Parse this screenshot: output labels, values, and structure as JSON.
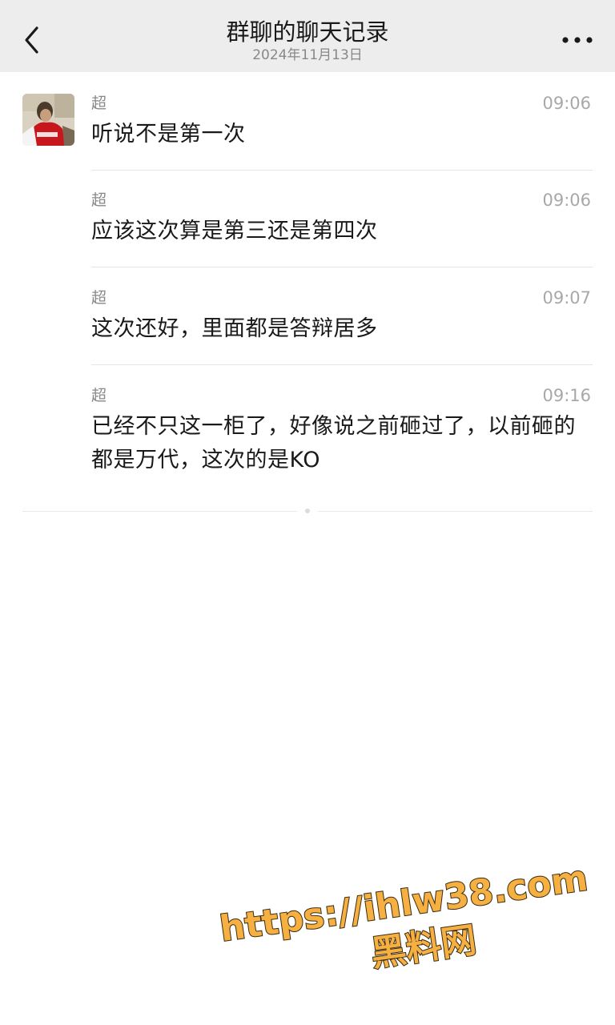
{
  "header": {
    "title": "群聊的聊天记录",
    "subtitle": "2024年11月13日",
    "back_icon": "chevron-left-icon",
    "more_icon": "ellipsis-icon"
  },
  "messages": [
    {
      "sender": "超",
      "time": "09:06",
      "text": "听说不是第一次"
    },
    {
      "sender": "超",
      "time": "09:06",
      "text": "应该这次算是第三还是第四次"
    },
    {
      "sender": "超",
      "time": "09:07",
      "text": "这次还好，里面都是答辩居多"
    },
    {
      "sender": "超",
      "time": "09:16",
      "text": "已经不只这一柜了，好像说之前砸过了，以前砸的都是万代，这次的是KO"
    }
  ],
  "watermark": {
    "url": "https://ihlw38.com",
    "name": "黑料网",
    "color": "#f5b041"
  },
  "colors": {
    "header_bg": "#ededed",
    "text_primary": "#191919",
    "text_secondary": "#888888"
  }
}
